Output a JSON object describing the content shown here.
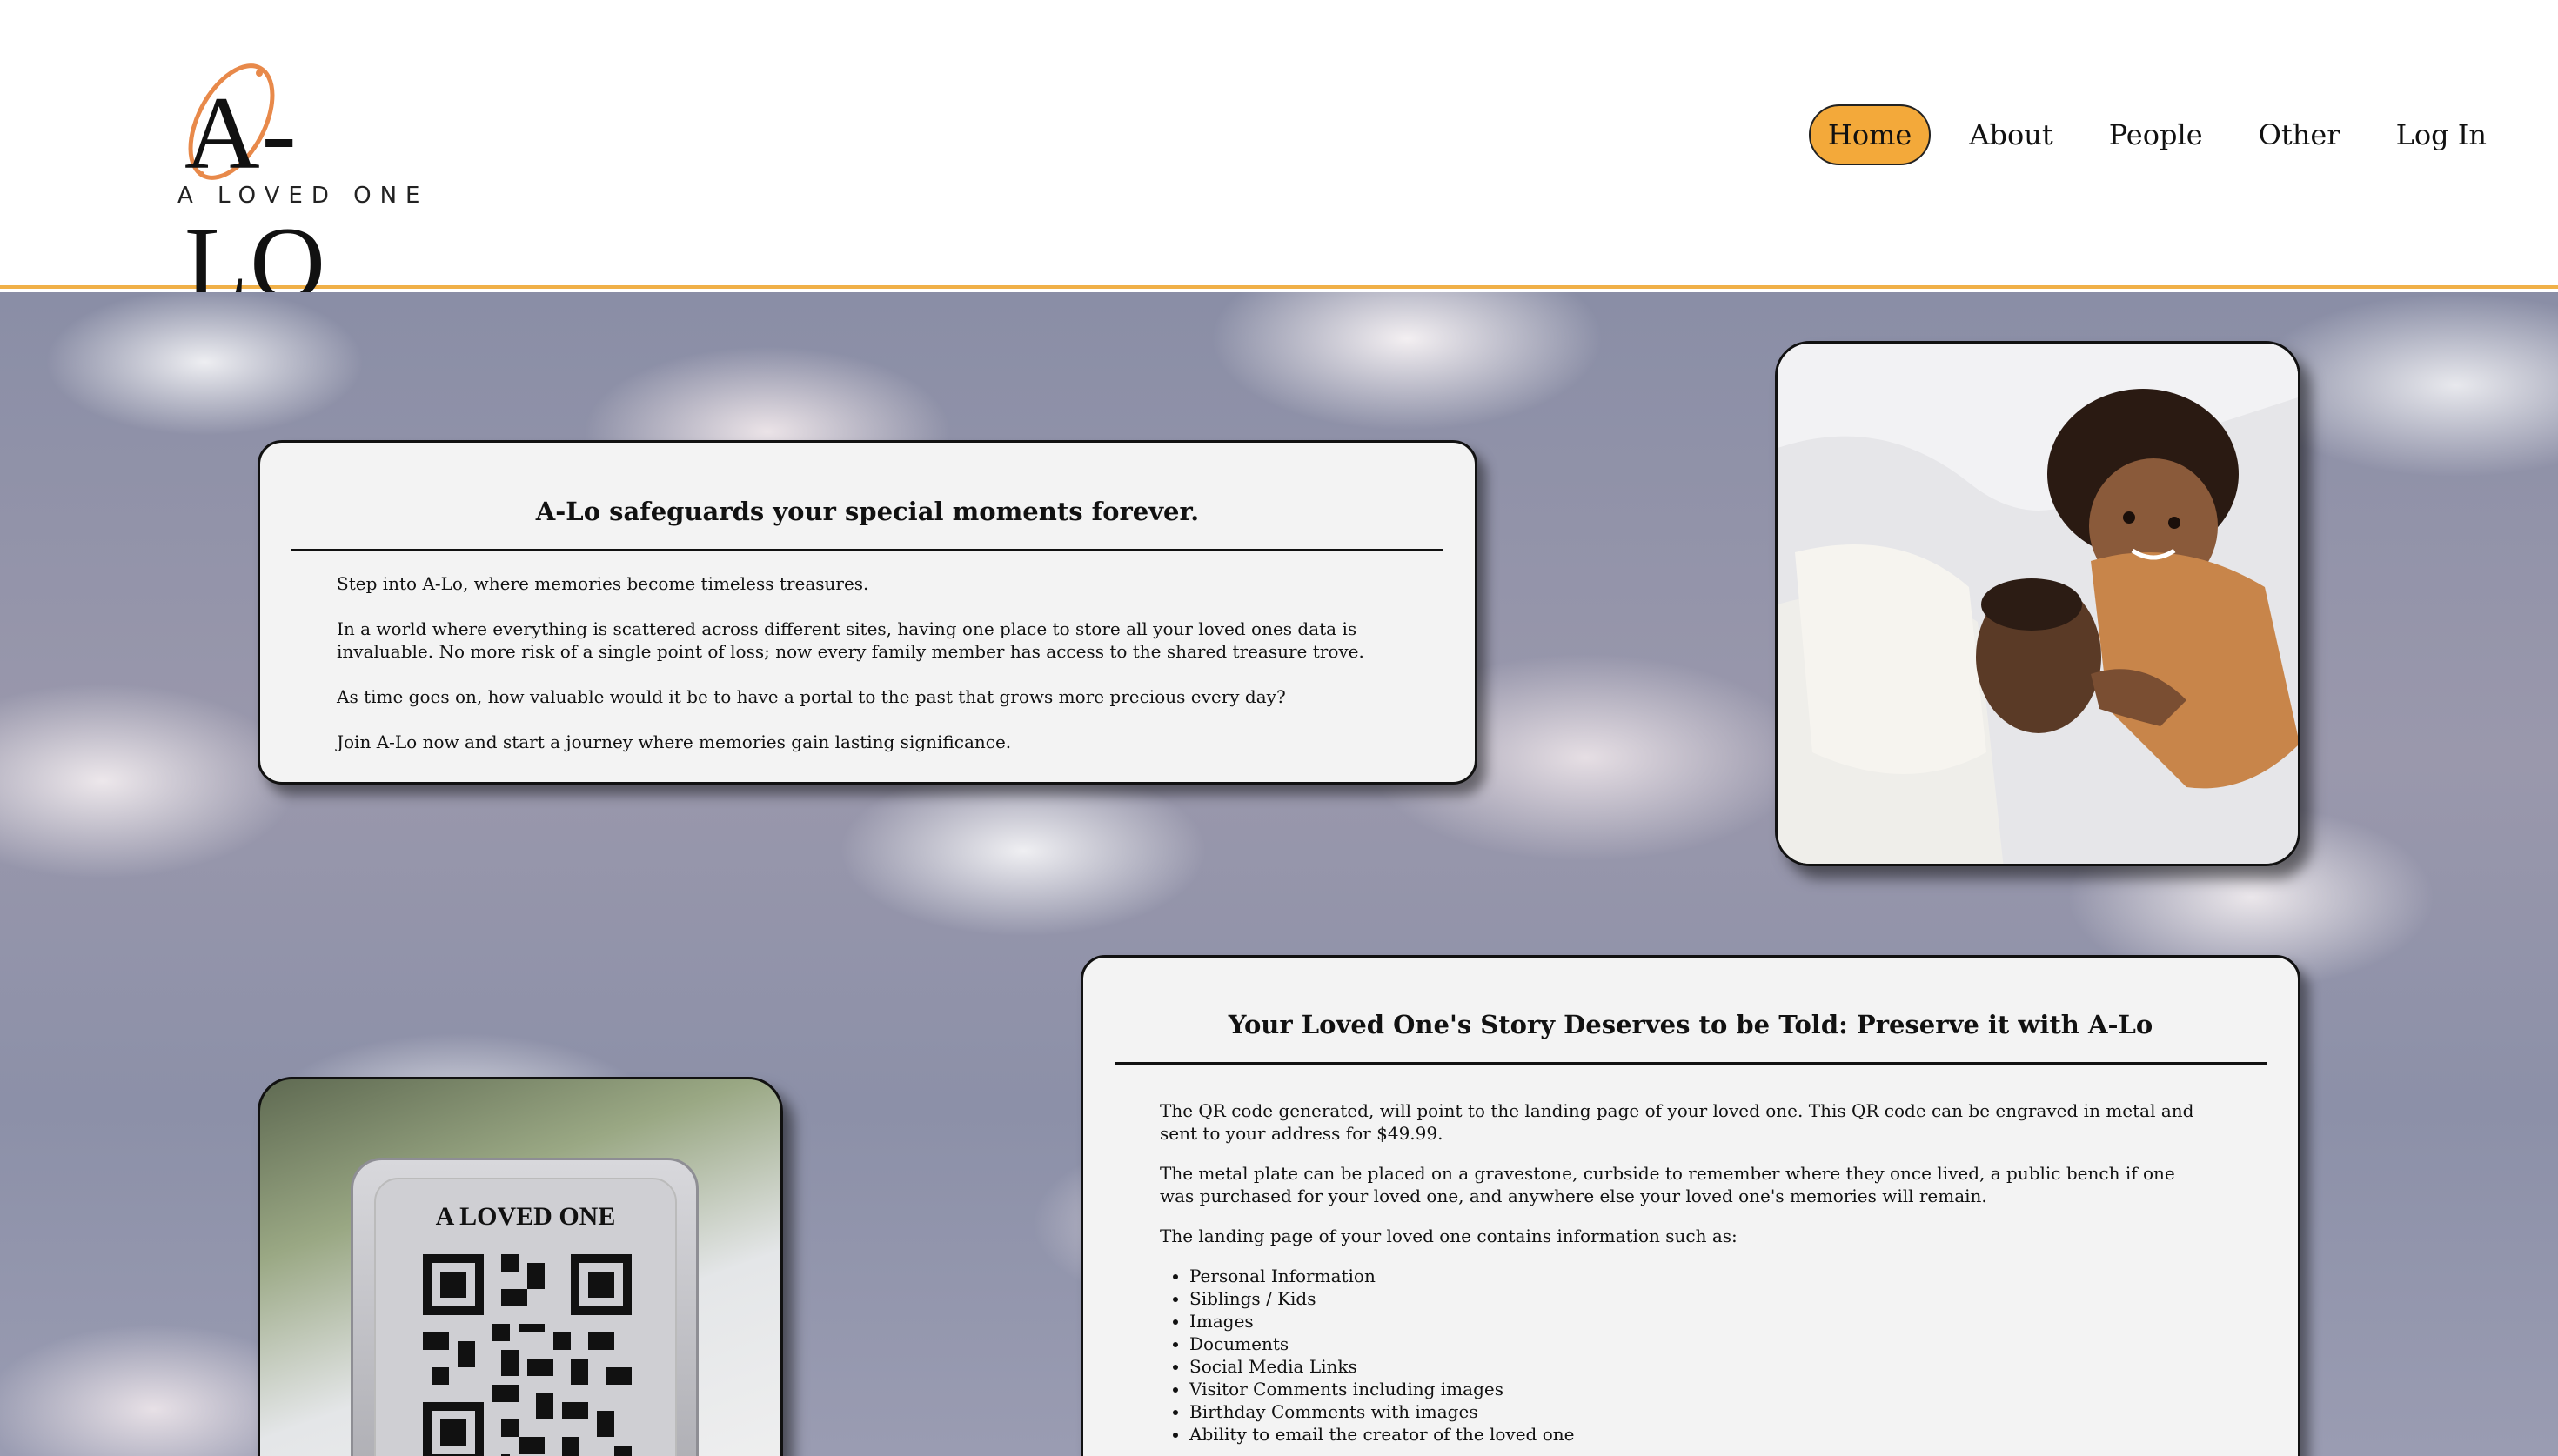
{
  "brand": {
    "logo_text": "A-LO",
    "tagline": "A LOVED ONE",
    "accent_color": "#f3a93a"
  },
  "nav": {
    "items": [
      {
        "label": "Home",
        "active": true
      },
      {
        "label": "About",
        "active": false
      },
      {
        "label": "People",
        "active": false
      },
      {
        "label": "Other",
        "active": false
      },
      {
        "label": "Log In",
        "active": false
      }
    ]
  },
  "intro_card": {
    "title": "A-Lo safeguards your special moments forever.",
    "paragraphs": [
      "Step into A-Lo, where memories become timeless treasures.",
      "In a world where everything is scattered across different sites, having one place to store all your loved ones data is invaluable. No more risk of a single point of loss; now every family member has access to the shared treasure trove.",
      "As time goes on, how valuable would it be to have a portal to the past that grows more precious every day?",
      "Join A-Lo now and start a journey where memories gain lasting significance."
    ]
  },
  "story_card": {
    "title": "Your Loved One's Story Deserves to be Told: Preserve it with A-Lo",
    "paragraphs": [
      "The QR code generated, will point to the landing page of your loved one. This QR code can be engraved in metal and sent to your address for $49.99.",
      "The metal plate can be placed on a gravestone, curbside to remember where they once lived, a public bench if one was purchased for your loved one, and anywhere else your loved one's memories will remain.",
      "The landing page of your loved one contains information such as:"
    ],
    "list": [
      "Personal Information",
      "Siblings / Kids",
      "Images",
      "Documents",
      "Social Media Links",
      "Visitor Comments including images",
      "Birthday Comments with images",
      "Ability to email the creator of the loved one"
    ]
  },
  "qr_plate": {
    "label": "A LOVED ONE"
  }
}
